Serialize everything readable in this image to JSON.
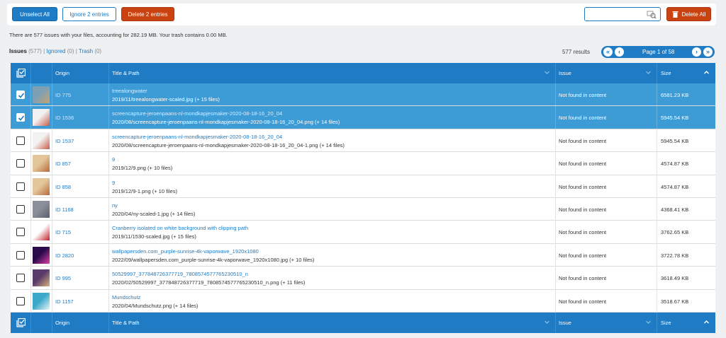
{
  "toolbar": {
    "unselect_all": "Unselect All",
    "ignore": "Ignore 2 entries",
    "delete": "Delete 2 entries",
    "search_placeholder": "",
    "delete_all": "Delete All"
  },
  "info_text": "There are 577 issues with your files, accounting for 282.19 MB. Your trash contains 0.00 MB.",
  "tabs": {
    "issues_label": "Issues",
    "issues_count": "(577)",
    "sep1": "|",
    "ignored_label": "Ignored",
    "ignored_count": "(0)",
    "sep2": "|",
    "trash_label": "Trash",
    "trash_count": "(0)"
  },
  "results": "577 results",
  "pager": {
    "label": "Page 1 of 58",
    "first": "«",
    "prev": "‹",
    "next": "›",
    "last": "»"
  },
  "columns": {
    "origin": "Origin",
    "title_path": "Title & Path",
    "issue": "Issue",
    "size": "Size"
  },
  "rows": [
    {
      "selected": true,
      "id": "ID 775",
      "title": "treealongwater",
      "path": "2019/11/treealongwater-scaled.jpg (+ 15 files)",
      "issue": "Not found in content",
      "size": "6581.23 KB",
      "thumb": [
        "#7ea0b5",
        "#c9a46b"
      ]
    },
    {
      "selected": true,
      "id": "ID 1536",
      "title": "screencapture-jeroenpaans-nl-mondkapjesmaker-2020-08-18-16_20_04",
      "path": "2020/08/screencapture-jeroenpaans-nl-mondkapjesmaker-2020-08-18-16_20_04.png (+ 14 files)",
      "issue": "Not found in content",
      "size": "5945.54 KB",
      "thumb": [
        "#f2f2f2",
        "#c85a4a"
      ]
    },
    {
      "selected": false,
      "id": "ID 1537",
      "title": "screencapture-jeroenpaans-nl-mondkapjesmaker-2020-08-18-16_20_04",
      "path": "2020/08/screencapture-jeroenpaans-nl-mondkapjesmaker-2020-08-18-16_20_04-1.png (+ 14 files)",
      "issue": "Not found in content",
      "size": "5945.54 KB",
      "thumb": [
        "#f2f2f2",
        "#c85a4a"
      ]
    },
    {
      "selected": false,
      "id": "ID 857",
      "title": "9",
      "path": "2019/12/9.png (+ 10 files)",
      "issue": "Not found in content",
      "size": "4574.87 KB",
      "thumb": [
        "#e3c79a",
        "#b66a3c"
      ]
    },
    {
      "selected": false,
      "id": "ID 858",
      "title": "9",
      "path": "2019/12/9-1.png (+ 10 files)",
      "issue": "Not found in content",
      "size": "4574.87 KB",
      "thumb": [
        "#e3c79a",
        "#b66a3c"
      ]
    },
    {
      "selected": false,
      "id": "ID 1168",
      "title": "ny",
      "path": "2020/04/ny-scaled-1.jpg (+ 14 files)",
      "issue": "Not found in content",
      "size": "4368.41 KB",
      "thumb": [
        "#8a8f99",
        "#5a6070"
      ]
    },
    {
      "selected": false,
      "id": "ID 715",
      "title": "Cranberry isolated on white background with clipping path",
      "path": "2019/11/1530-scaled.jpg (+ 15 files)",
      "issue": "Not found in content",
      "size": "3762.65 KB",
      "thumb": [
        "#ffffff",
        "#c41e2a"
      ]
    },
    {
      "selected": false,
      "id": "ID 2820",
      "title": "wallpapersden.com_purple-sunrise-4k-vaporwave_1920x1080",
      "path": "2022/09/wallpapersden.com_purple-sunrise-4k-vaporwave_1920x1080.jpg (+ 10 files)",
      "issue": "Not found in content",
      "size": "3722.78 KB",
      "thumb": [
        "#2a0a4a",
        "#e23fa8"
      ]
    },
    {
      "selected": false,
      "id": "ID 995",
      "title": "50529997_377848726377719_7808574577765230510_n",
      "path": "2020/02/50529997_377848726377719_7808574577765230510_n.png (+ 11 files)",
      "issue": "Not found in content",
      "size": "3618.49 KB",
      "thumb": [
        "#5a3a6a",
        "#d8b27a"
      ]
    },
    {
      "selected": false,
      "id": "ID 1157",
      "title": "Mundschutz",
      "path": "2020/04/Mundschutz.png (+ 14 files)",
      "issue": "Not found in content",
      "size": "3518.67 KB",
      "thumb": [
        "#3aa8c8",
        "#e8f4f8"
      ]
    }
  ],
  "colors": {
    "accent": "#1e7bc4",
    "selected_row": "#3d9bd6",
    "danger": "#c9420f"
  }
}
